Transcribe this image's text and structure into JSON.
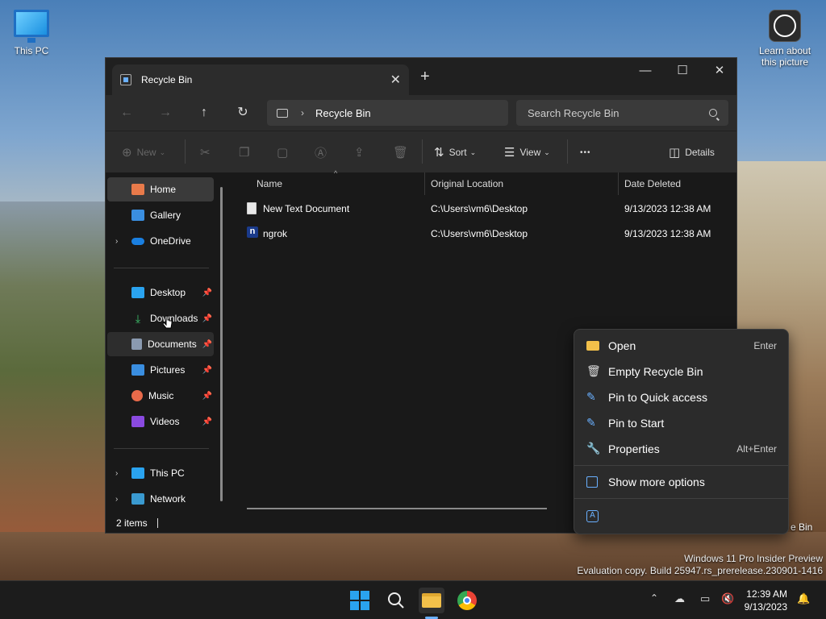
{
  "desktop": {
    "icons": [
      {
        "label": "This PC"
      },
      {
        "label": "Learn about this picture"
      }
    ],
    "recycle_label_fragment": "e Bin",
    "watermark": {
      "line1": "Windows 11 Pro Insider Preview",
      "line2": "Evaluation copy. Build 25947.rs_prerelease.230901-1416"
    }
  },
  "window": {
    "tab_title": "Recycle Bin",
    "new_tab_glyph": "+",
    "address": {
      "location": "Recycle Bin"
    },
    "search": {
      "placeholder": "Search Recycle Bin"
    },
    "toolbar": {
      "new_label": "New",
      "sort_label": "Sort",
      "view_label": "View",
      "more_glyph": "•••",
      "details_label": "Details"
    },
    "nav": {
      "items": [
        {
          "label": "Home",
          "state": "selected"
        },
        {
          "label": "Gallery"
        },
        {
          "label": "OneDrive",
          "expandable": true
        },
        {
          "label": "Desktop",
          "pinned": true
        },
        {
          "label": "Downloads",
          "pinned": true
        },
        {
          "label": "Documents",
          "pinned": true,
          "state": "hover"
        },
        {
          "label": "Pictures",
          "pinned": true
        },
        {
          "label": "Music",
          "pinned": true
        },
        {
          "label": "Videos",
          "pinned": true
        },
        {
          "label": "This PC",
          "expandable": true
        },
        {
          "label": "Network",
          "expandable": true
        }
      ]
    },
    "columns": [
      "Name",
      "Original Location",
      "Date Deleted"
    ],
    "rows": [
      {
        "name": "New Text Document",
        "location": "C:\\Users\\vm6\\Desktop",
        "date": "9/13/2023 12:38 AM"
      },
      {
        "name": "ngrok",
        "location": "C:\\Users\\vm6\\Desktop",
        "date": "9/13/2023 12:38 AM"
      }
    ],
    "status": {
      "count": "2 items"
    }
  },
  "context_menu": {
    "items": [
      {
        "label": "Open",
        "shortcut": "Enter",
        "icon": "folder-icon"
      },
      {
        "label": "Empty Recycle Bin",
        "icon": "trash-icon"
      },
      {
        "label": "Pin to Quick access",
        "icon": "pin-icon"
      },
      {
        "label": "Pin to Start",
        "icon": "pin-icon"
      },
      {
        "label": "Properties",
        "shortcut": "Alt+Enter",
        "icon": "wrench-icon"
      },
      {
        "label": "Show more options",
        "icon": "more-options-icon"
      }
    ]
  },
  "taskbar": {
    "time": "12:39 AM",
    "date": "9/13/2023"
  },
  "colors": {
    "accent": "#2aa3ef",
    "window_bg": "#191919",
    "chrome_bg": "#2c2c2c"
  }
}
